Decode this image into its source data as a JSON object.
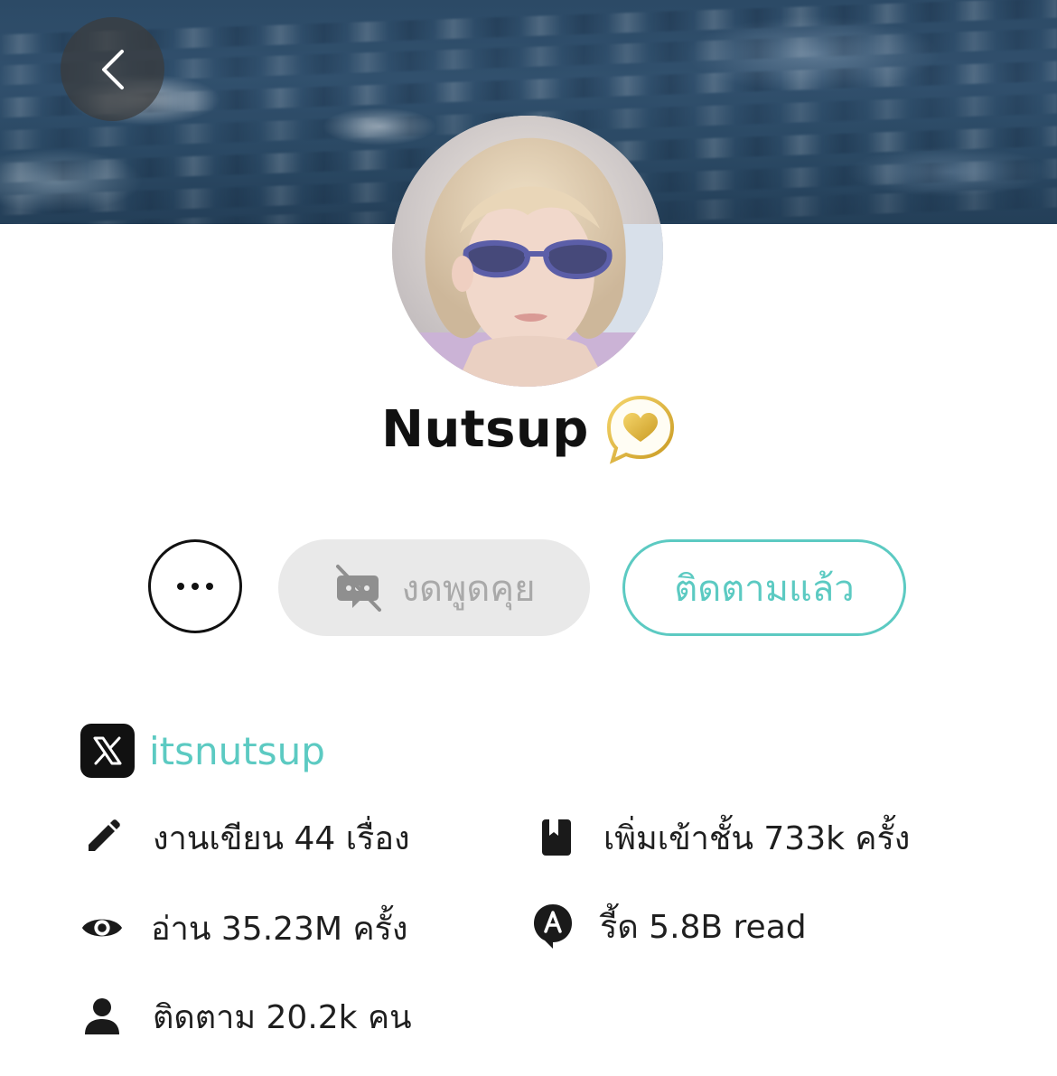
{
  "profile": {
    "name": "Nutsup",
    "badge_icon": "gold-heart-chat-badge-icon",
    "avatar_description": "avatar-photo"
  },
  "actions": {
    "more_icon": "more-dots-icon",
    "chat_label": "งดพูดคุย",
    "chat_icon": "chat-disabled-icon",
    "follow_label": "ติดตามแล้ว"
  },
  "social": {
    "x_icon": "x-logo-icon",
    "x_handle": "itsnutsup"
  },
  "stats": {
    "works": "งานเขียน 44 เรื่อง",
    "shelf_adds": "เพิ่มเข้าชั้น 733k ครั้ง",
    "reads": "อ่าน 35.23M ครั้ง",
    "reeds": "รี้ด 5.8B read",
    "followers": "ติดตาม 20.2k คน"
  },
  "colors": {
    "accent": "#5ccac2",
    "disabled_bg": "#e9e9e9",
    "disabled_text": "#a9a9a9",
    "gold": "#e2b437"
  }
}
